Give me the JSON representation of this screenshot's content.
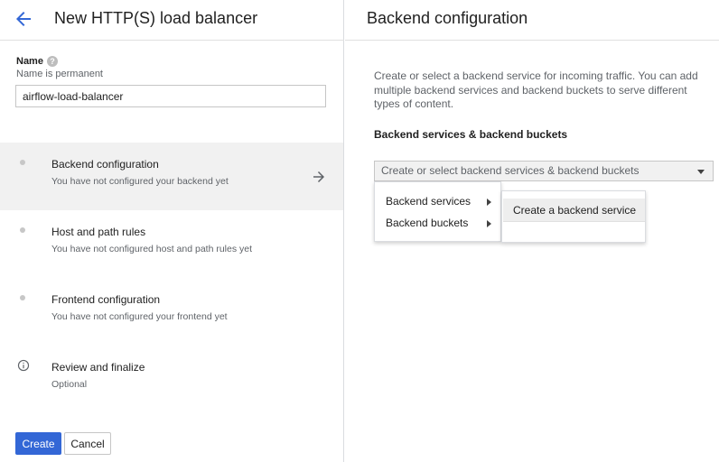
{
  "header": {
    "title": "New HTTP(S) load balancer"
  },
  "name_field": {
    "label": "Name",
    "help_icon": "?",
    "hint": "Name is permanent",
    "value": "airflow-load-balancer"
  },
  "steps": [
    {
      "title": "Backend configuration",
      "subtitle": "You have not configured your backend yet",
      "active": true,
      "icon": "dot-icon"
    },
    {
      "title": "Host and path rules",
      "subtitle": "You have not configured host and path rules yet",
      "active": false,
      "icon": "dot-icon"
    },
    {
      "title": "Frontend configuration",
      "subtitle": "You have not configured your frontend yet",
      "active": false,
      "icon": "dot-icon"
    },
    {
      "title": "Review and finalize",
      "subtitle": "Optional",
      "active": false,
      "icon": "info-icon"
    }
  ],
  "buttons": {
    "create": "Create",
    "cancel": "Cancel"
  },
  "backend_panel": {
    "title": "Backend configuration",
    "description": "Create or select a backend service for incoming traffic. You can add multiple backend services and backend buckets to serve different types of content.",
    "subheading": "Backend services & backend buckets",
    "select_placeholder": "Create or select backend services & backend buckets",
    "menu_items": [
      "Backend services",
      "Backend buckets"
    ],
    "submenu_items": [
      "Create a backend service"
    ]
  },
  "colors": {
    "primary": "#3367d6",
    "active_step_bg": "#f1f1f1",
    "border": "#dadce0"
  }
}
